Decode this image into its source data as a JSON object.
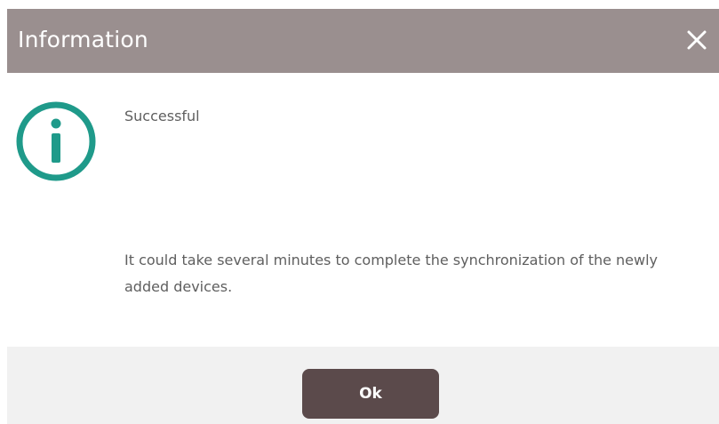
{
  "dialog": {
    "title": "Information",
    "close_icon": "close-icon",
    "status_icon": "info-icon",
    "status_text": "Successful",
    "message": "It could take several minutes to complete the synchronization of the newly added devices.",
    "ok_label": "Ok"
  },
  "colors": {
    "titlebar": "#9a8f8f",
    "icon_teal": "#1f9a8a",
    "button": "#5b4a4b",
    "footer": "#f1f1f1",
    "text": "#5f5f5f"
  }
}
